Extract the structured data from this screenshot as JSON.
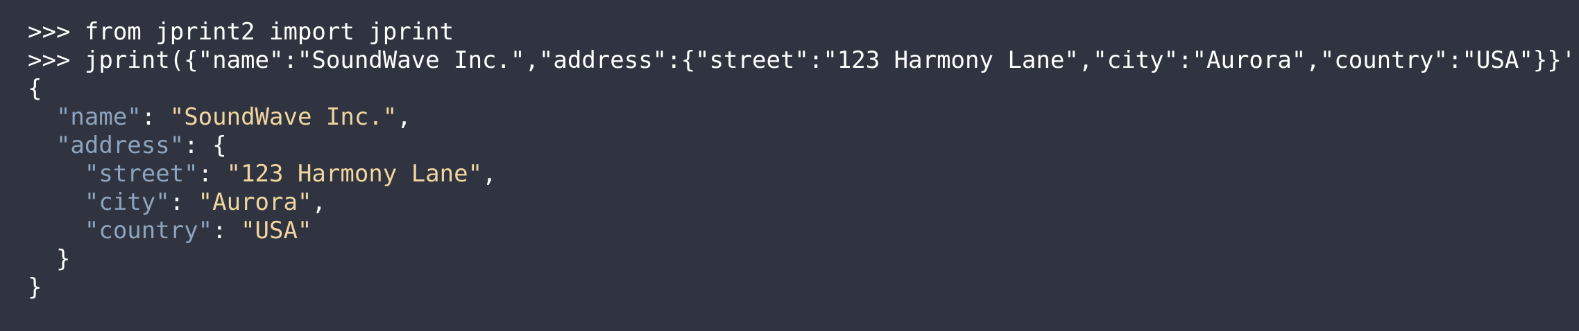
{
  "terminal": {
    "lines": [
      {
        "kind": "command",
        "prompt": ">>> ",
        "text": "from jprint2 import jprint"
      },
      {
        "kind": "command",
        "prompt": ">>> ",
        "text": "jprint({\"name\":\"SoundWave Inc.\",\"address\":{\"street\":\"123 Harmony Lane\",\"city\":\"Aurora\",\"country\":\"USA\"}}')"
      },
      {
        "kind": "output",
        "tokens": [
          {
            "t": "punct",
            "v": "{"
          }
        ]
      },
      {
        "kind": "output",
        "tokens": [
          {
            "t": "punct",
            "v": "  "
          },
          {
            "t": "key",
            "v": "\"name\""
          },
          {
            "t": "punct",
            "v": ": "
          },
          {
            "t": "str",
            "v": "\"SoundWave Inc.\""
          },
          {
            "t": "punct",
            "v": ","
          }
        ]
      },
      {
        "kind": "output",
        "tokens": [
          {
            "t": "punct",
            "v": "  "
          },
          {
            "t": "key",
            "v": "\"address\""
          },
          {
            "t": "punct",
            "v": ": {"
          }
        ]
      },
      {
        "kind": "output",
        "tokens": [
          {
            "t": "punct",
            "v": "    "
          },
          {
            "t": "key",
            "v": "\"street\""
          },
          {
            "t": "punct",
            "v": ": "
          },
          {
            "t": "str",
            "v": "\"123 Harmony Lane\""
          },
          {
            "t": "punct",
            "v": ","
          }
        ]
      },
      {
        "kind": "output",
        "tokens": [
          {
            "t": "punct",
            "v": "    "
          },
          {
            "t": "key",
            "v": "\"city\""
          },
          {
            "t": "punct",
            "v": ": "
          },
          {
            "t": "str",
            "v": "\"Aurora\""
          },
          {
            "t": "punct",
            "v": ","
          }
        ]
      },
      {
        "kind": "output",
        "tokens": [
          {
            "t": "punct",
            "v": "    "
          },
          {
            "t": "key",
            "v": "\"country\""
          },
          {
            "t": "punct",
            "v": ": "
          },
          {
            "t": "str",
            "v": "\"USA\""
          }
        ]
      },
      {
        "kind": "output",
        "tokens": [
          {
            "t": "punct",
            "v": "  }"
          }
        ]
      },
      {
        "kind": "output",
        "tokens": [
          {
            "t": "punct",
            "v": "}"
          }
        ]
      }
    ]
  },
  "colors": {
    "background": "#2f3440",
    "text": "#ffffff",
    "json_key": "#8ea3bd",
    "json_string": "#f2d6a0"
  }
}
